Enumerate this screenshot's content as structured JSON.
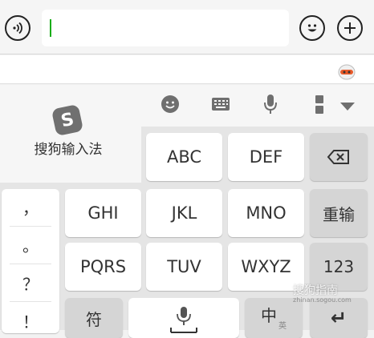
{
  "chat": {
    "input_value": ""
  },
  "ime": {
    "name": "搜狗输入法",
    "logo_letter": "S"
  },
  "keys": {
    "row1": [
      "ABC",
      "DEF"
    ],
    "row2": [
      "GHI",
      "JKL",
      "MNO"
    ],
    "row3": [
      "PQRS",
      "TUV",
      "WXYZ"
    ],
    "delete": "⌫",
    "reinput": "重输",
    "number": "123",
    "symbol": "符",
    "lang_main": "中",
    "lang_sub": "英",
    "enter": "↵"
  },
  "punctuation": [
    "，",
    "。",
    "？",
    "！"
  ],
  "watermark": {
    "title": "搜狗指南",
    "url": "zhinan.sogou.com"
  },
  "colors": {
    "caret": "#1aad19",
    "keyboard_bg": "#e5e5e5",
    "function_key": "#d5d5d5"
  }
}
